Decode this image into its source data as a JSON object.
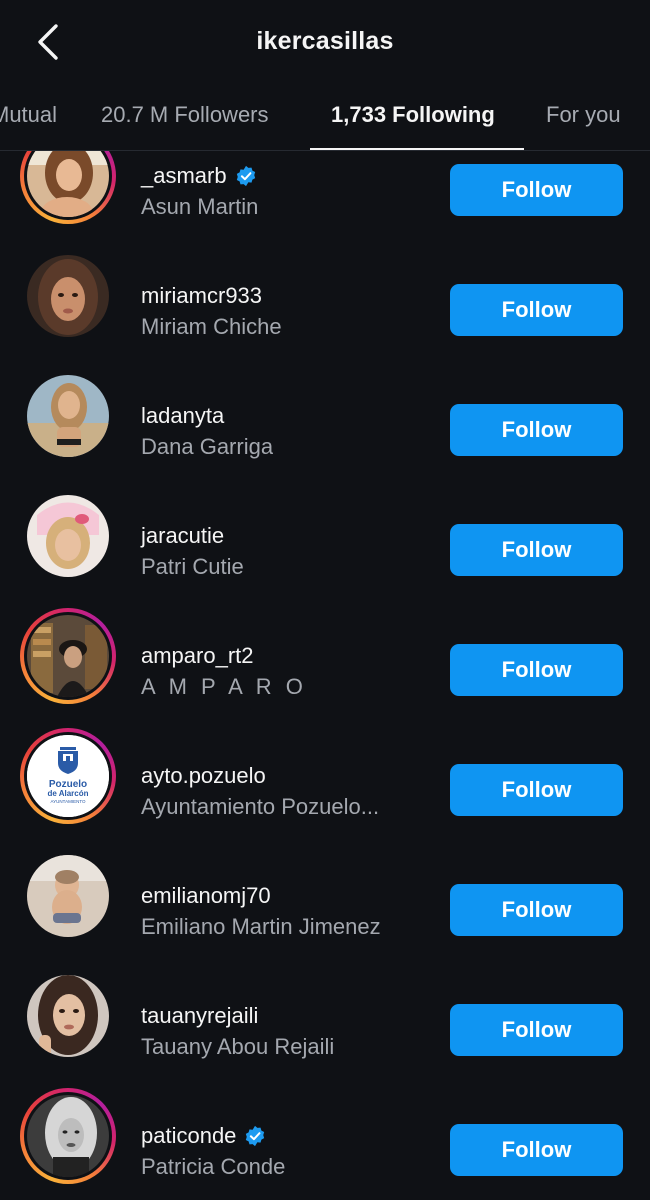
{
  "header": {
    "title": "ikercasillas",
    "back_icon": "chevron-left-icon"
  },
  "tabs": [
    {
      "label": "Mutual"
    },
    {
      "label": "20.7 M Followers"
    },
    {
      "label": "1,733 Following",
      "active": true
    },
    {
      "label": "For you"
    }
  ],
  "list": {
    "items": [
      {
        "username": "_asmarb",
        "name": "Asun Martin",
        "verified": true,
        "story_ring": true,
        "button": "Follow"
      },
      {
        "username": "miriamcr933",
        "name": "Miriam Chiche",
        "verified": false,
        "story_ring": false,
        "button": "Follow"
      },
      {
        "username": "ladanyta",
        "name": "Dana Garriga",
        "verified": false,
        "story_ring": false,
        "button": "Follow"
      },
      {
        "username": "jaracutie",
        "name": "Patri Cutie",
        "verified": false,
        "story_ring": false,
        "button": "Follow"
      },
      {
        "username": "amparo_rt2",
        "name": "A M P A R O",
        "verified": false,
        "story_ring": true,
        "button": "Follow"
      },
      {
        "username": "ayto.pozuelo",
        "name": "Ayuntamiento Pozuelo...",
        "verified": false,
        "story_ring": true,
        "button": "Follow",
        "logo_text": [
          "Pozuelo",
          "de Alarcón",
          "AYUNTAMIENTO"
        ]
      },
      {
        "username": "emilianomj70",
        "name": "Emiliano Martin Jimenez",
        "verified": false,
        "story_ring": false,
        "button": "Follow"
      },
      {
        "username": "tauanyrejaili",
        "name": "Tauany Abou Rejaili",
        "verified": false,
        "story_ring": false,
        "button": "Follow"
      },
      {
        "username": "paticonde",
        "name": "Patricia Conde",
        "verified": true,
        "story_ring": true,
        "button": "Follow"
      }
    ]
  },
  "colors": {
    "background": "#0f1115",
    "accent": "#0f95f2",
    "verified": "#1d9bf0"
  }
}
